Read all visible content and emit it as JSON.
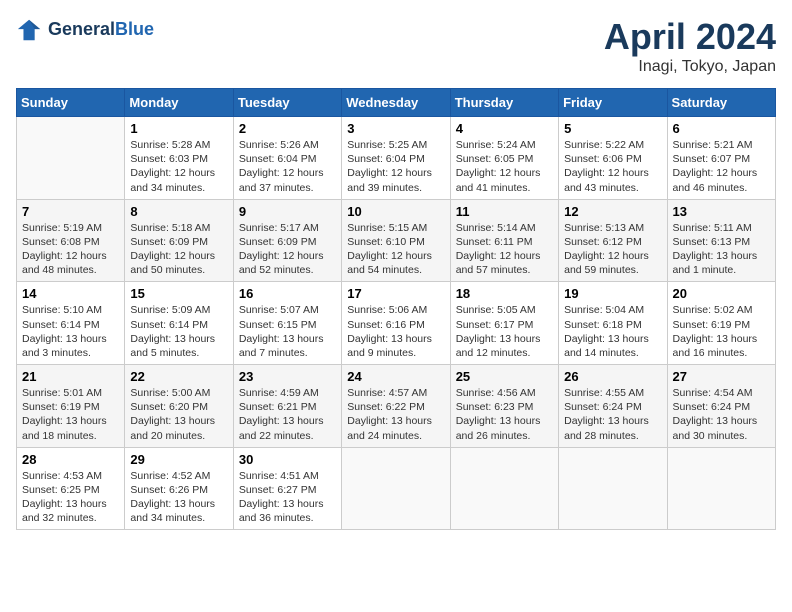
{
  "header": {
    "logo_line1": "General",
    "logo_line2": "Blue",
    "calendar_title": "April 2024",
    "calendar_subtitle": "Inagi, Tokyo, Japan"
  },
  "days_of_week": [
    "Sunday",
    "Monday",
    "Tuesday",
    "Wednesday",
    "Thursday",
    "Friday",
    "Saturday"
  ],
  "weeks": [
    [
      {
        "day": "",
        "info": ""
      },
      {
        "day": "1",
        "info": "Sunrise: 5:28 AM\nSunset: 6:03 PM\nDaylight: 12 hours\nand 34 minutes."
      },
      {
        "day": "2",
        "info": "Sunrise: 5:26 AM\nSunset: 6:04 PM\nDaylight: 12 hours\nand 37 minutes."
      },
      {
        "day": "3",
        "info": "Sunrise: 5:25 AM\nSunset: 6:04 PM\nDaylight: 12 hours\nand 39 minutes."
      },
      {
        "day": "4",
        "info": "Sunrise: 5:24 AM\nSunset: 6:05 PM\nDaylight: 12 hours\nand 41 minutes."
      },
      {
        "day": "5",
        "info": "Sunrise: 5:22 AM\nSunset: 6:06 PM\nDaylight: 12 hours\nand 43 minutes."
      },
      {
        "day": "6",
        "info": "Sunrise: 5:21 AM\nSunset: 6:07 PM\nDaylight: 12 hours\nand 46 minutes."
      }
    ],
    [
      {
        "day": "7",
        "info": "Sunrise: 5:19 AM\nSunset: 6:08 PM\nDaylight: 12 hours\nand 48 minutes."
      },
      {
        "day": "8",
        "info": "Sunrise: 5:18 AM\nSunset: 6:09 PM\nDaylight: 12 hours\nand 50 minutes."
      },
      {
        "day": "9",
        "info": "Sunrise: 5:17 AM\nSunset: 6:09 PM\nDaylight: 12 hours\nand 52 minutes."
      },
      {
        "day": "10",
        "info": "Sunrise: 5:15 AM\nSunset: 6:10 PM\nDaylight: 12 hours\nand 54 minutes."
      },
      {
        "day": "11",
        "info": "Sunrise: 5:14 AM\nSunset: 6:11 PM\nDaylight: 12 hours\nand 57 minutes."
      },
      {
        "day": "12",
        "info": "Sunrise: 5:13 AM\nSunset: 6:12 PM\nDaylight: 12 hours\nand 59 minutes."
      },
      {
        "day": "13",
        "info": "Sunrise: 5:11 AM\nSunset: 6:13 PM\nDaylight: 13 hours\nand 1 minute."
      }
    ],
    [
      {
        "day": "14",
        "info": "Sunrise: 5:10 AM\nSunset: 6:14 PM\nDaylight: 13 hours\nand 3 minutes."
      },
      {
        "day": "15",
        "info": "Sunrise: 5:09 AM\nSunset: 6:14 PM\nDaylight: 13 hours\nand 5 minutes."
      },
      {
        "day": "16",
        "info": "Sunrise: 5:07 AM\nSunset: 6:15 PM\nDaylight: 13 hours\nand 7 minutes."
      },
      {
        "day": "17",
        "info": "Sunrise: 5:06 AM\nSunset: 6:16 PM\nDaylight: 13 hours\nand 9 minutes."
      },
      {
        "day": "18",
        "info": "Sunrise: 5:05 AM\nSunset: 6:17 PM\nDaylight: 13 hours\nand 12 minutes."
      },
      {
        "day": "19",
        "info": "Sunrise: 5:04 AM\nSunset: 6:18 PM\nDaylight: 13 hours\nand 14 minutes."
      },
      {
        "day": "20",
        "info": "Sunrise: 5:02 AM\nSunset: 6:19 PM\nDaylight: 13 hours\nand 16 minutes."
      }
    ],
    [
      {
        "day": "21",
        "info": "Sunrise: 5:01 AM\nSunset: 6:19 PM\nDaylight: 13 hours\nand 18 minutes."
      },
      {
        "day": "22",
        "info": "Sunrise: 5:00 AM\nSunset: 6:20 PM\nDaylight: 13 hours\nand 20 minutes."
      },
      {
        "day": "23",
        "info": "Sunrise: 4:59 AM\nSunset: 6:21 PM\nDaylight: 13 hours\nand 22 minutes."
      },
      {
        "day": "24",
        "info": "Sunrise: 4:57 AM\nSunset: 6:22 PM\nDaylight: 13 hours\nand 24 minutes."
      },
      {
        "day": "25",
        "info": "Sunrise: 4:56 AM\nSunset: 6:23 PM\nDaylight: 13 hours\nand 26 minutes."
      },
      {
        "day": "26",
        "info": "Sunrise: 4:55 AM\nSunset: 6:24 PM\nDaylight: 13 hours\nand 28 minutes."
      },
      {
        "day": "27",
        "info": "Sunrise: 4:54 AM\nSunset: 6:24 PM\nDaylight: 13 hours\nand 30 minutes."
      }
    ],
    [
      {
        "day": "28",
        "info": "Sunrise: 4:53 AM\nSunset: 6:25 PM\nDaylight: 13 hours\nand 32 minutes."
      },
      {
        "day": "29",
        "info": "Sunrise: 4:52 AM\nSunset: 6:26 PM\nDaylight: 13 hours\nand 34 minutes."
      },
      {
        "day": "30",
        "info": "Sunrise: 4:51 AM\nSunset: 6:27 PM\nDaylight: 13 hours\nand 36 minutes."
      },
      {
        "day": "",
        "info": ""
      },
      {
        "day": "",
        "info": ""
      },
      {
        "day": "",
        "info": ""
      },
      {
        "day": "",
        "info": ""
      }
    ]
  ]
}
